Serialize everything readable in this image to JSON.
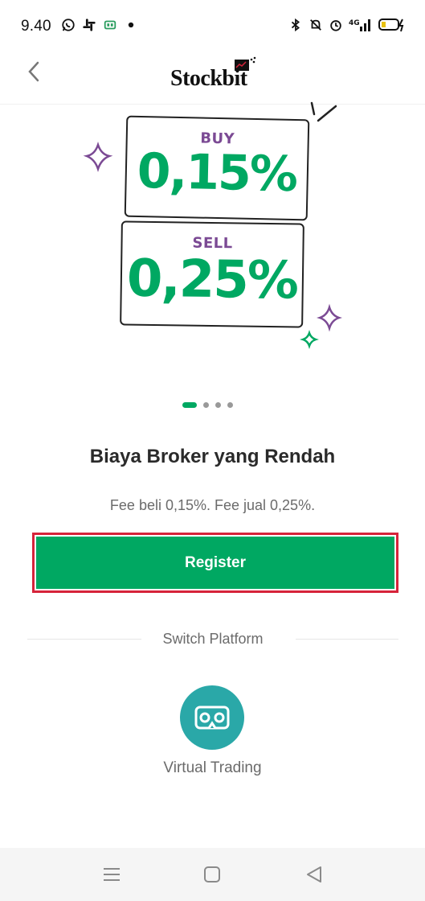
{
  "status_bar": {
    "time": "9.40",
    "left_icons": [
      "whatsapp-icon",
      "slack-icon",
      "battery-saver-icon",
      "dot-icon"
    ],
    "right_icons": [
      "bluetooth-icon",
      "mute-icon",
      "alarm-icon",
      "signal-4g-icon",
      "battery-charging-icon"
    ],
    "network": "4G"
  },
  "header": {
    "back_icon": "chevron-left-icon",
    "logo_text": "Stockbit"
  },
  "banner": {
    "buy_label": "BUY",
    "buy_value": "0,15%",
    "sell_label": "SELL",
    "sell_value": "0,25%"
  },
  "pager": {
    "count": 4,
    "active_index": 0
  },
  "content": {
    "headline": "Biaya Broker yang Rendah",
    "subtext": "Fee beli 0,15%. Fee jual 0,25%."
  },
  "register_button": {
    "label": "Register"
  },
  "switch_platform": {
    "label": "Switch Platform",
    "option_label": "Virtual Trading",
    "option_icon": "vr-headset-icon"
  },
  "colors": {
    "brand_green": "#00a862",
    "purple": "#7b4a94",
    "teal": "#2aa8a8",
    "highlight_red": "#d6233a"
  },
  "nav_bar": {
    "items": [
      "menu-icon",
      "home-icon",
      "back-icon"
    ]
  }
}
